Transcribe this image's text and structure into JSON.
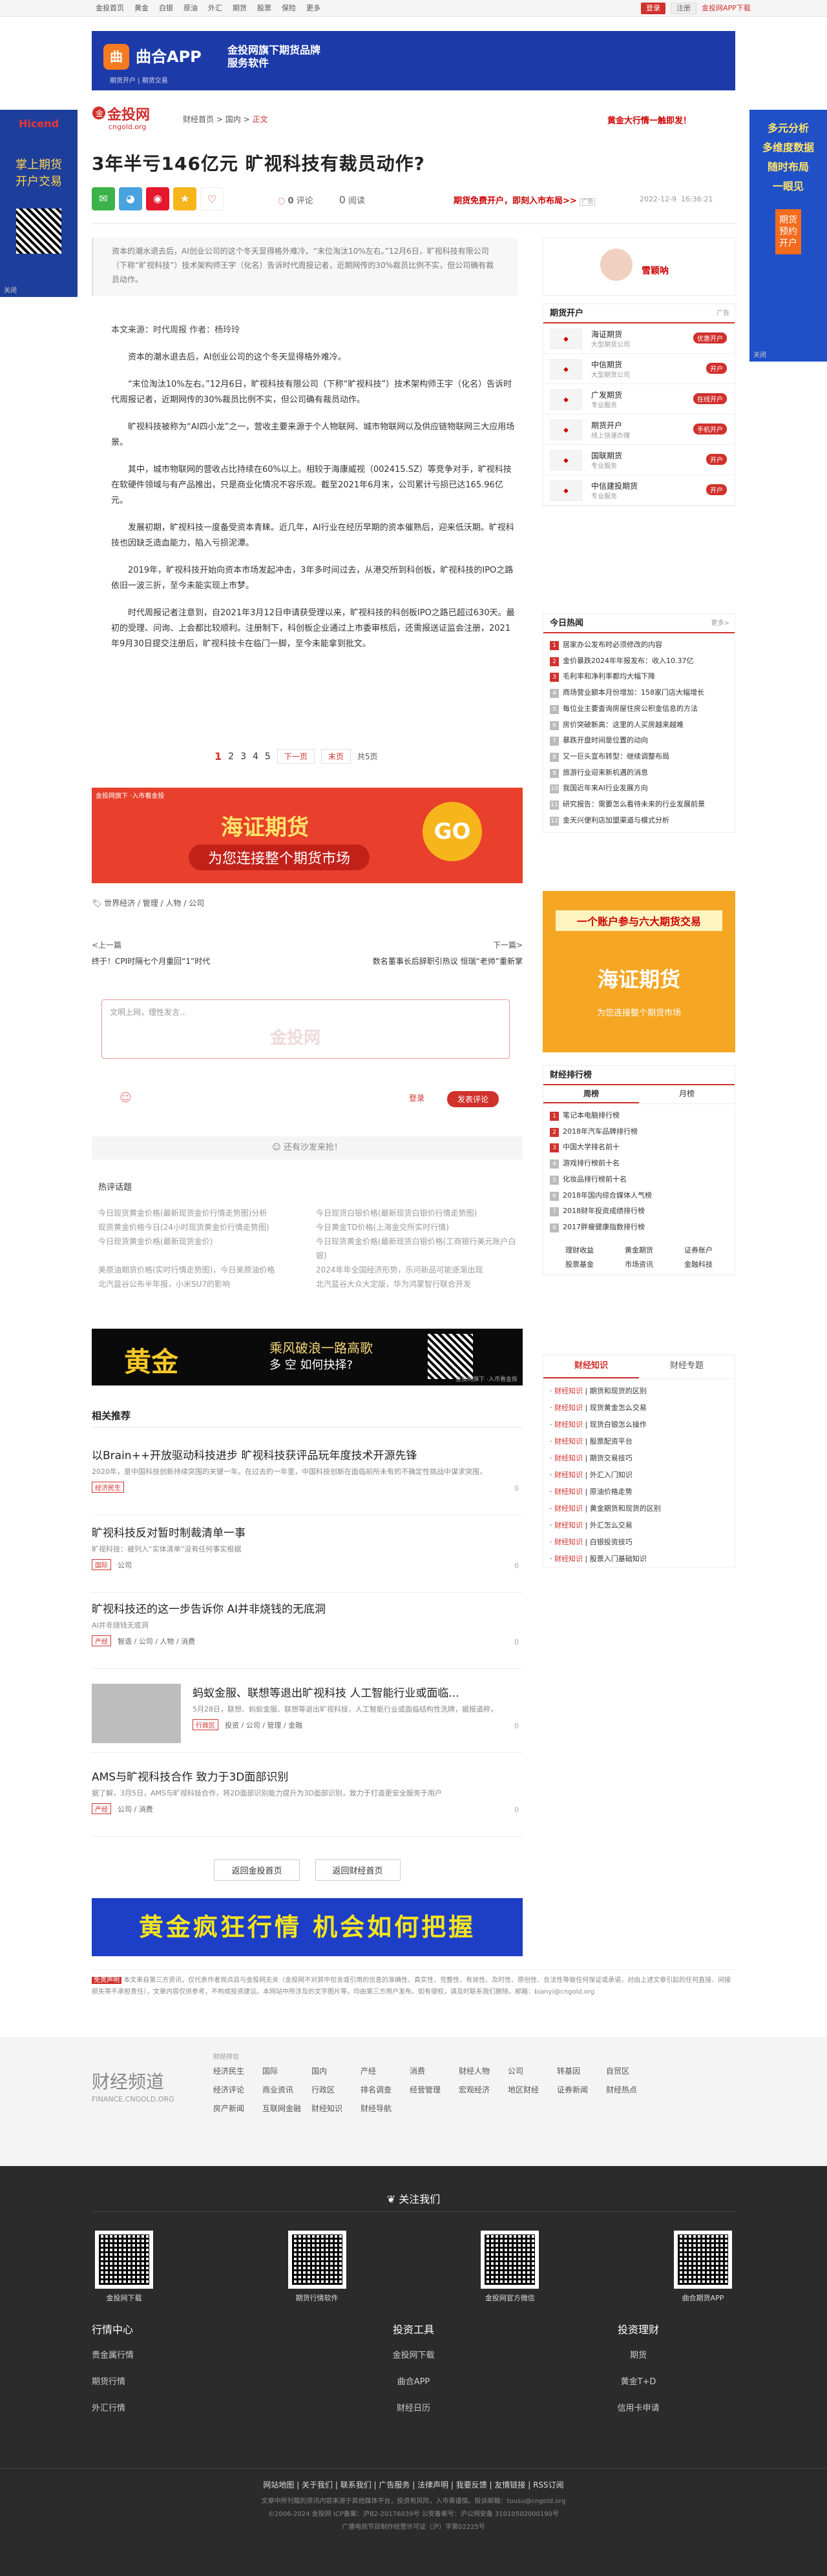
{
  "topnav": [
    "金投首页",
    "黄金",
    "白银",
    "原油",
    "外汇",
    "期货",
    "股票",
    "保险",
    "更多"
  ],
  "top_right": {
    "login": "登录",
    "register": "注册",
    "download": "金投网APP下载"
  },
  "top_ad": {
    "logo": "曲",
    "name": "曲合APP",
    "slogan": "金投网旗下期货品牌服务软件",
    "sub": "期货开户 | 期货交易"
  },
  "side_ad_left": {
    "brand": "Hicend",
    "text": "掌上期货\n开户交易",
    "close": "关闭"
  },
  "side_ad_right": {
    "text": "多元分析\n多维度数据\n随时布局\n一眼见",
    "open": "期货预约开户",
    "close": "关闭"
  },
  "logo": {
    "cn": "金投网",
    "en": "cngold.org"
  },
  "breadcrumb": {
    "a": "财经首页",
    "sep": ">",
    "b": "国内",
    "c": "正文"
  },
  "hot_link": "黄金大行情一触即发！",
  "title": "3年半亏146亿元 旷视科技有裁员动作?",
  "meta": {
    "comments": "0",
    "comments_label": "评论",
    "reads": "0",
    "reads_label": "阅读",
    "futures_ad": "期货免费开户，即刻入市布局>>",
    "ad": "广告",
    "date": "2022-12-9",
    "time": "16:36:21"
  },
  "summary": "资本的潮水退去后，AI创业公司的这个冬天显得格外难冷。“末位淘汰10%左右。”12月6日，旷视科技有限公司（下称“旷视科技”）技术架构师王宇（化名）告诉时代周报记者，近期网传的30%裁员比例不实，但公司确有裁员动作。",
  "author": {
    "name": "雪颖呐"
  },
  "article": {
    "source": "本文来源：时代周报 作者：杨玲玲",
    "paras": [
      "资本的潮水退去后，AI创业公司的这个冬天显得格外难冷。",
      "“末位淘汰10%左右。”12月6日，旷视科技有限公司（下称“旷视科技”）技术架构师王宇（化名）告诉时代周报记者，近期网传的30%裁员比例不实，但公司确有裁员动作。",
      "旷视科技被称为“AI四小龙”之一，营收主要来源于个人物联网、城市物联网以及供应链物联网三大应用场景。",
      "其中，城市物联网的营收占比持续在60%以上。相较于海康威视（002415.SZ）等竞争对手，旷视科技在软硬件领域与有产品推出，只是商业化情况不容乐观。截至2021年6月末，公司累计亏损已达165.96亿元。",
      "发展初期，旷视科技一度备受资本青睐。近几年，AI行业在经历早期的资本催熟后，迎来低沃期。旷视科技也因缺乏造血能力，陷入亏损泥潭。",
      "2019年，旷视科技开始向资本市场发起冲击，3年多时间过去，从港交所到科创板，旷视科技的IPO之路依旧一波三折，至今未能实现上市梦。",
      "时代周报记者注意到，自2021年3月12日申请获受理以来，旷视科技的科创板IPO之路已超过630天。最初的受理、问询、上会都比较顺利。注册制下，科创板企业通过上市委审核后，还需报送证监会注册，2021年9月30日提交注册后，旷视科技卡在临门一脚，至今未能拿到批文。"
    ]
  },
  "pager": {
    "pages": [
      "1",
      "2",
      "3",
      "4",
      "5"
    ],
    "next": "下一页",
    "last": "末页",
    "all": "共5页"
  },
  "mid_ad": {
    "brand": "海证期货",
    "slogan": "为您连接整个期货市场",
    "go": "GO",
    "tip": "金投网旗下 ·入市看金投"
  },
  "tags": "世界经济 / 管理 / 人物 / 公司",
  "prevnext": {
    "prev_label": "<上一篇",
    "prev": "终于！CPI时隔七个月重回“1”时代",
    "next_label": "下一篇>",
    "next": "数名董事长后辞职引热议 恒瑞“老帅”重新掌"
  },
  "comment": {
    "placeholder": "文明上网，理性发言...",
    "watermark": "金投网",
    "login": "登录",
    "post": "发表评论",
    "empty": "还有沙发来抢！"
  },
  "hot_topics_h": "热评话题",
  "hot_topics": [
    "今日现货黄金价格(最新现货金价行情走势图)分析",
    "今日现货白银价格(最新现货白银价行情走势图)",
    "现货黄金价格今日(24小时现货黄金价行情走势图)",
    "今日黄金TD价格(上海金交所实时行情)",
    "今日现货黄金价格(最新现货金价)",
    "今日现货黄金价格(最新现货白银价格(工商银行美元账户白银)",
    "美原油期货价格(实时行情走势图)，今日美原油价格",
    "2024年年全国经济形势，乐问新品可能逐渐出现",
    "北汽蓝谷公布半年报，小米SU7的影响",
    "北汽蓝谷大众大定版，华为鸿蒙智行联合开发"
  ],
  "gold_ad": {
    "t1": "黄金",
    "t2": "乘风破浪一路高歌",
    "t3": "多 空 如何抉择?",
    "tip": "金投网旗下 ·入市看金投"
  },
  "related_h": "相关推荐",
  "related": [
    {
      "t": "以Brain++开放驱动科技进步 旷视科技获评品玩年度技术开源先锋",
      "d": "2020年，是中国科技创新持续突围的关键一年。在过去的一年里，中国科技创新在面临前所未有的不确定性挑战中谋求突围，",
      "tag": "经济民生",
      "cnt": "0"
    },
    {
      "t": "旷视科技反对暂时制裁清单一事",
      "d": "旷视科技：被列入“实体清单”没有任何事实根据",
      "tag": "国际",
      "m": "公司",
      "cnt": "0"
    },
    {
      "t": "旷视科技还的这一步告诉你 AI并非烧钱的无底洞",
      "d": "AI并非烧钱无底洞",
      "tag": "产经",
      "m": "智造 / 公司 / 人物 / 消费",
      "cnt": "0"
    },
    {
      "t": "蚂蚁金服、联想等退出旷视科技 人工智能行业或面临...",
      "d": "5月28日，联想、蚂蚁金服、联想等退出旷视科技，人工智能行业或面临结构性洗牌，据报道称，",
      "tag": "行政区",
      "m": "投资 / 公司 / 管理 / 金融",
      "cnt": "0"
    },
    {
      "t": "AMS与旷视科技合作 致力于3D面部识别",
      "d": "据了解，3月5日，AMS与旷视科技合作，将2D面部识别能力提升为3D面部识别，致力于打造更安全服务于用户",
      "tag": "产经",
      "m": "公司 / 消费",
      "cnt": "0"
    }
  ],
  "back": {
    "home": "返回金投首页",
    "finance": "返回财经首页"
  },
  "bottom_ad": "黄金疯狂行情 机会如何把握",
  "disclaimer": {
    "label": "免责声明",
    "text": "本文来自第三方资讯，仅代表作者观点且与金投网无关（金投网不对其中包含或引用的信息的准确性、真实性、完整性、有效性、及时性、原创性、合法性等做任何保证或承诺，对由上述文章引起的任何直接、间接损失等不承担责任），文章内容仅供参考，不构成投资建议。本网站中所涉及的文字图片等，均由第三方用户发布。如有侵权，请及时联系我们删除。邮箱：bianyi@cngold.org"
  },
  "side": {
    "open_h": "期货开户",
    "ad": "广告",
    "brokers": [
      {
        "n": "海证期货",
        "s": "大型期货公司",
        "b": "优惠开户"
      },
      {
        "n": "中信期货",
        "s": "大型期货公司",
        "b": "开户"
      },
      {
        "n": "广发期货",
        "s": "专业服务",
        "b": "在线开户"
      },
      {
        "n": "期货开户",
        "s": "线上快速办理",
        "b": "手机开户"
      },
      {
        "n": "国联期货",
        "s": "专业服务",
        "b": "开户"
      },
      {
        "n": "中信建投期货",
        "s": "专业服务",
        "b": "开户"
      }
    ],
    "hot_h": "今日热闻",
    "more": "更多>",
    "hot": [
      "居家办公发布时必须修改的内容",
      "金价暴跌2024年年报发布：收入10.37亿",
      "毛利率和净利率都均大幅下降",
      "商场营业额本月份增加：158家门店大幅增长",
      "每位业主要查询房屋住房公积金信息的方法",
      "房价突破新高：这里的人买房越来越难",
      "暴跌开盘时间是位置的动向",
      "又一巨头宣布转型：继续调整布局",
      "旅游行业迎来新机遇的消息",
      "我国近年来AI行业发展方向",
      "研究报告：需要怎么看待未来的行业发展前景",
      "金天兴便利店加盟渠道与模式分析"
    ],
    "rank_h": "财经排行榜",
    "rank_tabs": [
      "周榜",
      "月榜"
    ],
    "rank": [
      "笔记本电脑排行榜",
      "2018年汽车品牌排行榜",
      "中国大学排名前十",
      "游戏排行榜前十名",
      "化妆品排行榜前十名",
      "2018年国内综合媒体人气榜",
      "2018财年投资成绩排行榜",
      "2017胖瘦健康指数排行榜"
    ],
    "rank_grid": [
      "理财收益",
      "黄金期货",
      "证券账户",
      "股票基金",
      "市场资讯",
      "金融科技"
    ],
    "kn_tabs": [
      "财经知识",
      "财经专题"
    ],
    "kn": [
      "期货和现货的区别",
      "现货黄金怎么交易",
      "现货白银怎么操作",
      "股票配资平台",
      "期货交易技巧",
      "外汇入门知识",
      "原油价格走势",
      "黄金期货和现货的区别",
      "外汇怎么交易",
      "白银投资技巧",
      "股票入门基础知识"
    ],
    "kn_pre": "财经知识"
  },
  "channel": {
    "big": "财经频道",
    "en": "FINANCE.CNGOLD.ORG",
    "sub": "财经排信",
    "links": [
      "经济民生",
      "国际",
      "国内",
      "产经",
      "消费",
      "财经人物",
      "公司",
      "转基因",
      "自贸区",
      "经济评论",
      "商业资讯",
      "行政区",
      "排名调查",
      "经营管理",
      "宏观经济",
      "地区财经",
      "证券新闻",
      "财经热点",
      "房产新闻",
      "互联网金融",
      "财经知识",
      "财经导航"
    ]
  },
  "footer": {
    "title": "关注我们",
    "qrs": [
      "金投网下载",
      "期货行情软件",
      "金投网官方微信",
      "曲合期货APP"
    ],
    "cols": [
      {
        "h": "行情中心",
        "items": [
          "贵金属行情",
          "期货行情",
          "外汇行情"
        ]
      },
      {
        "h": "投资工具",
        "items": [
          "金投网下载",
          "曲合APP",
          "财经日历"
        ]
      },
      {
        "h": "投资理财",
        "items": [
          "期货",
          "黄金T+D",
          "信用卡申请"
        ]
      }
    ],
    "links": "网站地图 | 关于我们 | 联系我们 | 广告服务 | 法律声明 | 我要反馈 | 友情链接 | RSS订阅",
    "copy1": "文章中所刊载的资讯内容来源于其他媒体平台，投资有风险，入市需谨慎。投诉邮箱：tousu@cngold.org",
    "copy2": "©2006-2024 金投网 ICP备案：沪B2-20176039号  公安备案号：沪公网安备 31010502000190号",
    "copy3": "广播电视节目制作经营许可证（沪）字第02225号"
  }
}
